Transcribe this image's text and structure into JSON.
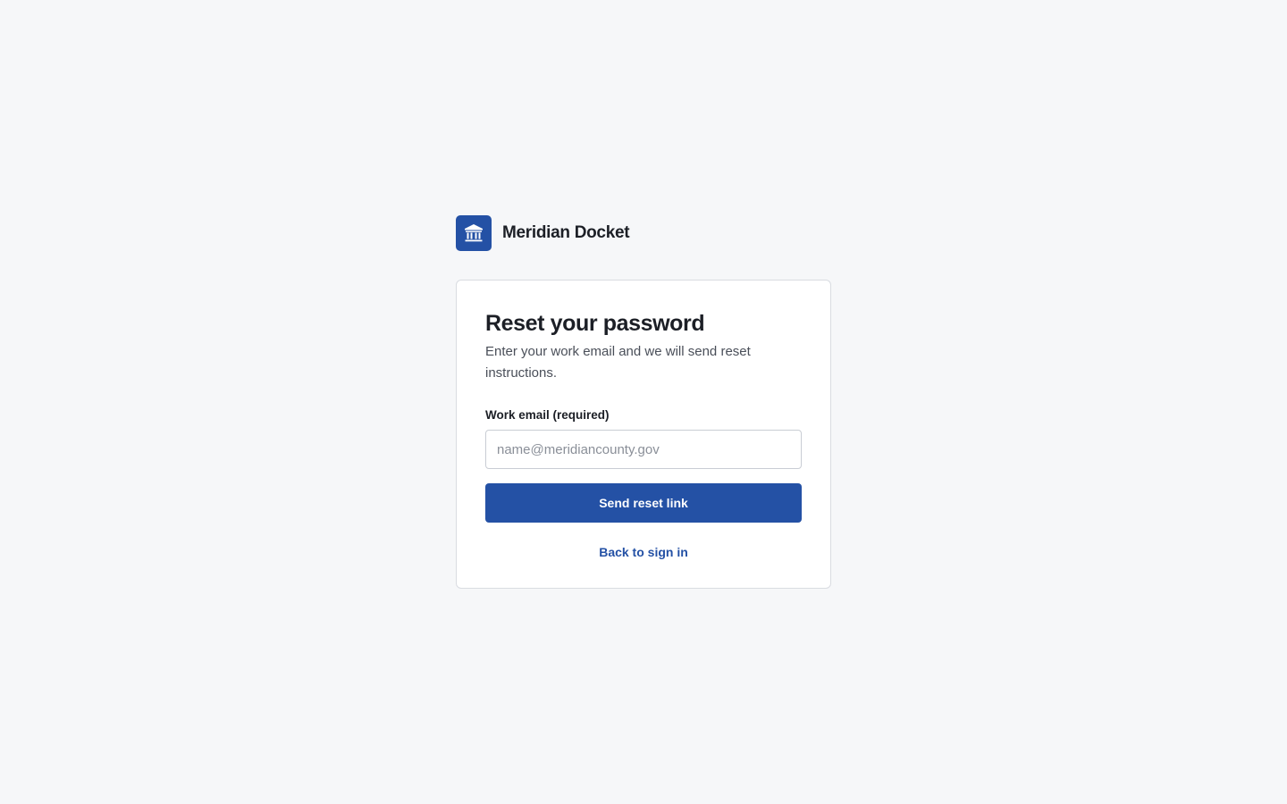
{
  "brand": {
    "name": "Meridian Docket",
    "logo_icon": "bank-building-icon",
    "accent_color": "#2451a5"
  },
  "card": {
    "title": "Reset your password",
    "subtitle": "Enter your work email and we will send reset instructions."
  },
  "form": {
    "email_label": "Work email (required)",
    "email_placeholder": "name@meridiancounty.gov",
    "email_value": "",
    "submit_label": "Send reset link"
  },
  "links": {
    "back_to_sign_in": "Back to sign in"
  }
}
